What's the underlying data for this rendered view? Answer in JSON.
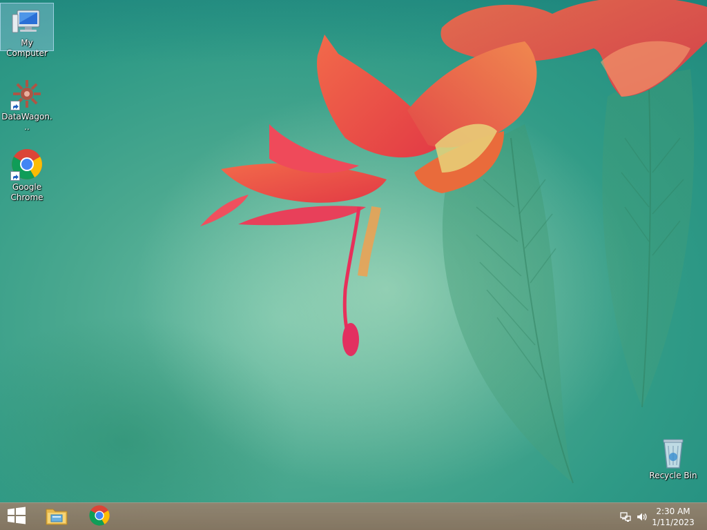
{
  "desktop": {
    "icons": [
      {
        "label": "My Computer",
        "icon": "computer-icon",
        "selected": true
      },
      {
        "label": "DataWagon...",
        "icon": "datawagon-icon",
        "shortcut": true
      },
      {
        "label": "Google Chrome",
        "icon": "chrome-icon",
        "shortcut": true
      },
      {
        "label": "Recycle Bin",
        "icon": "recycle-bin-icon"
      }
    ]
  },
  "taskbar": {
    "start_icon": "windows-start-icon",
    "pinned": [
      {
        "name": "File Explorer",
        "icon": "file-explorer-icon"
      },
      {
        "name": "Google Chrome",
        "icon": "chrome-icon"
      }
    ],
    "tray": {
      "network_icon": "network-icon",
      "volume_icon": "volume-icon",
      "time": "2:30 AM",
      "date": "1/11/2023"
    }
  },
  "colors": {
    "taskbar": "#8a7460",
    "wallpaper_teal": "#2f9a86",
    "flower_red": "#e8403a"
  }
}
